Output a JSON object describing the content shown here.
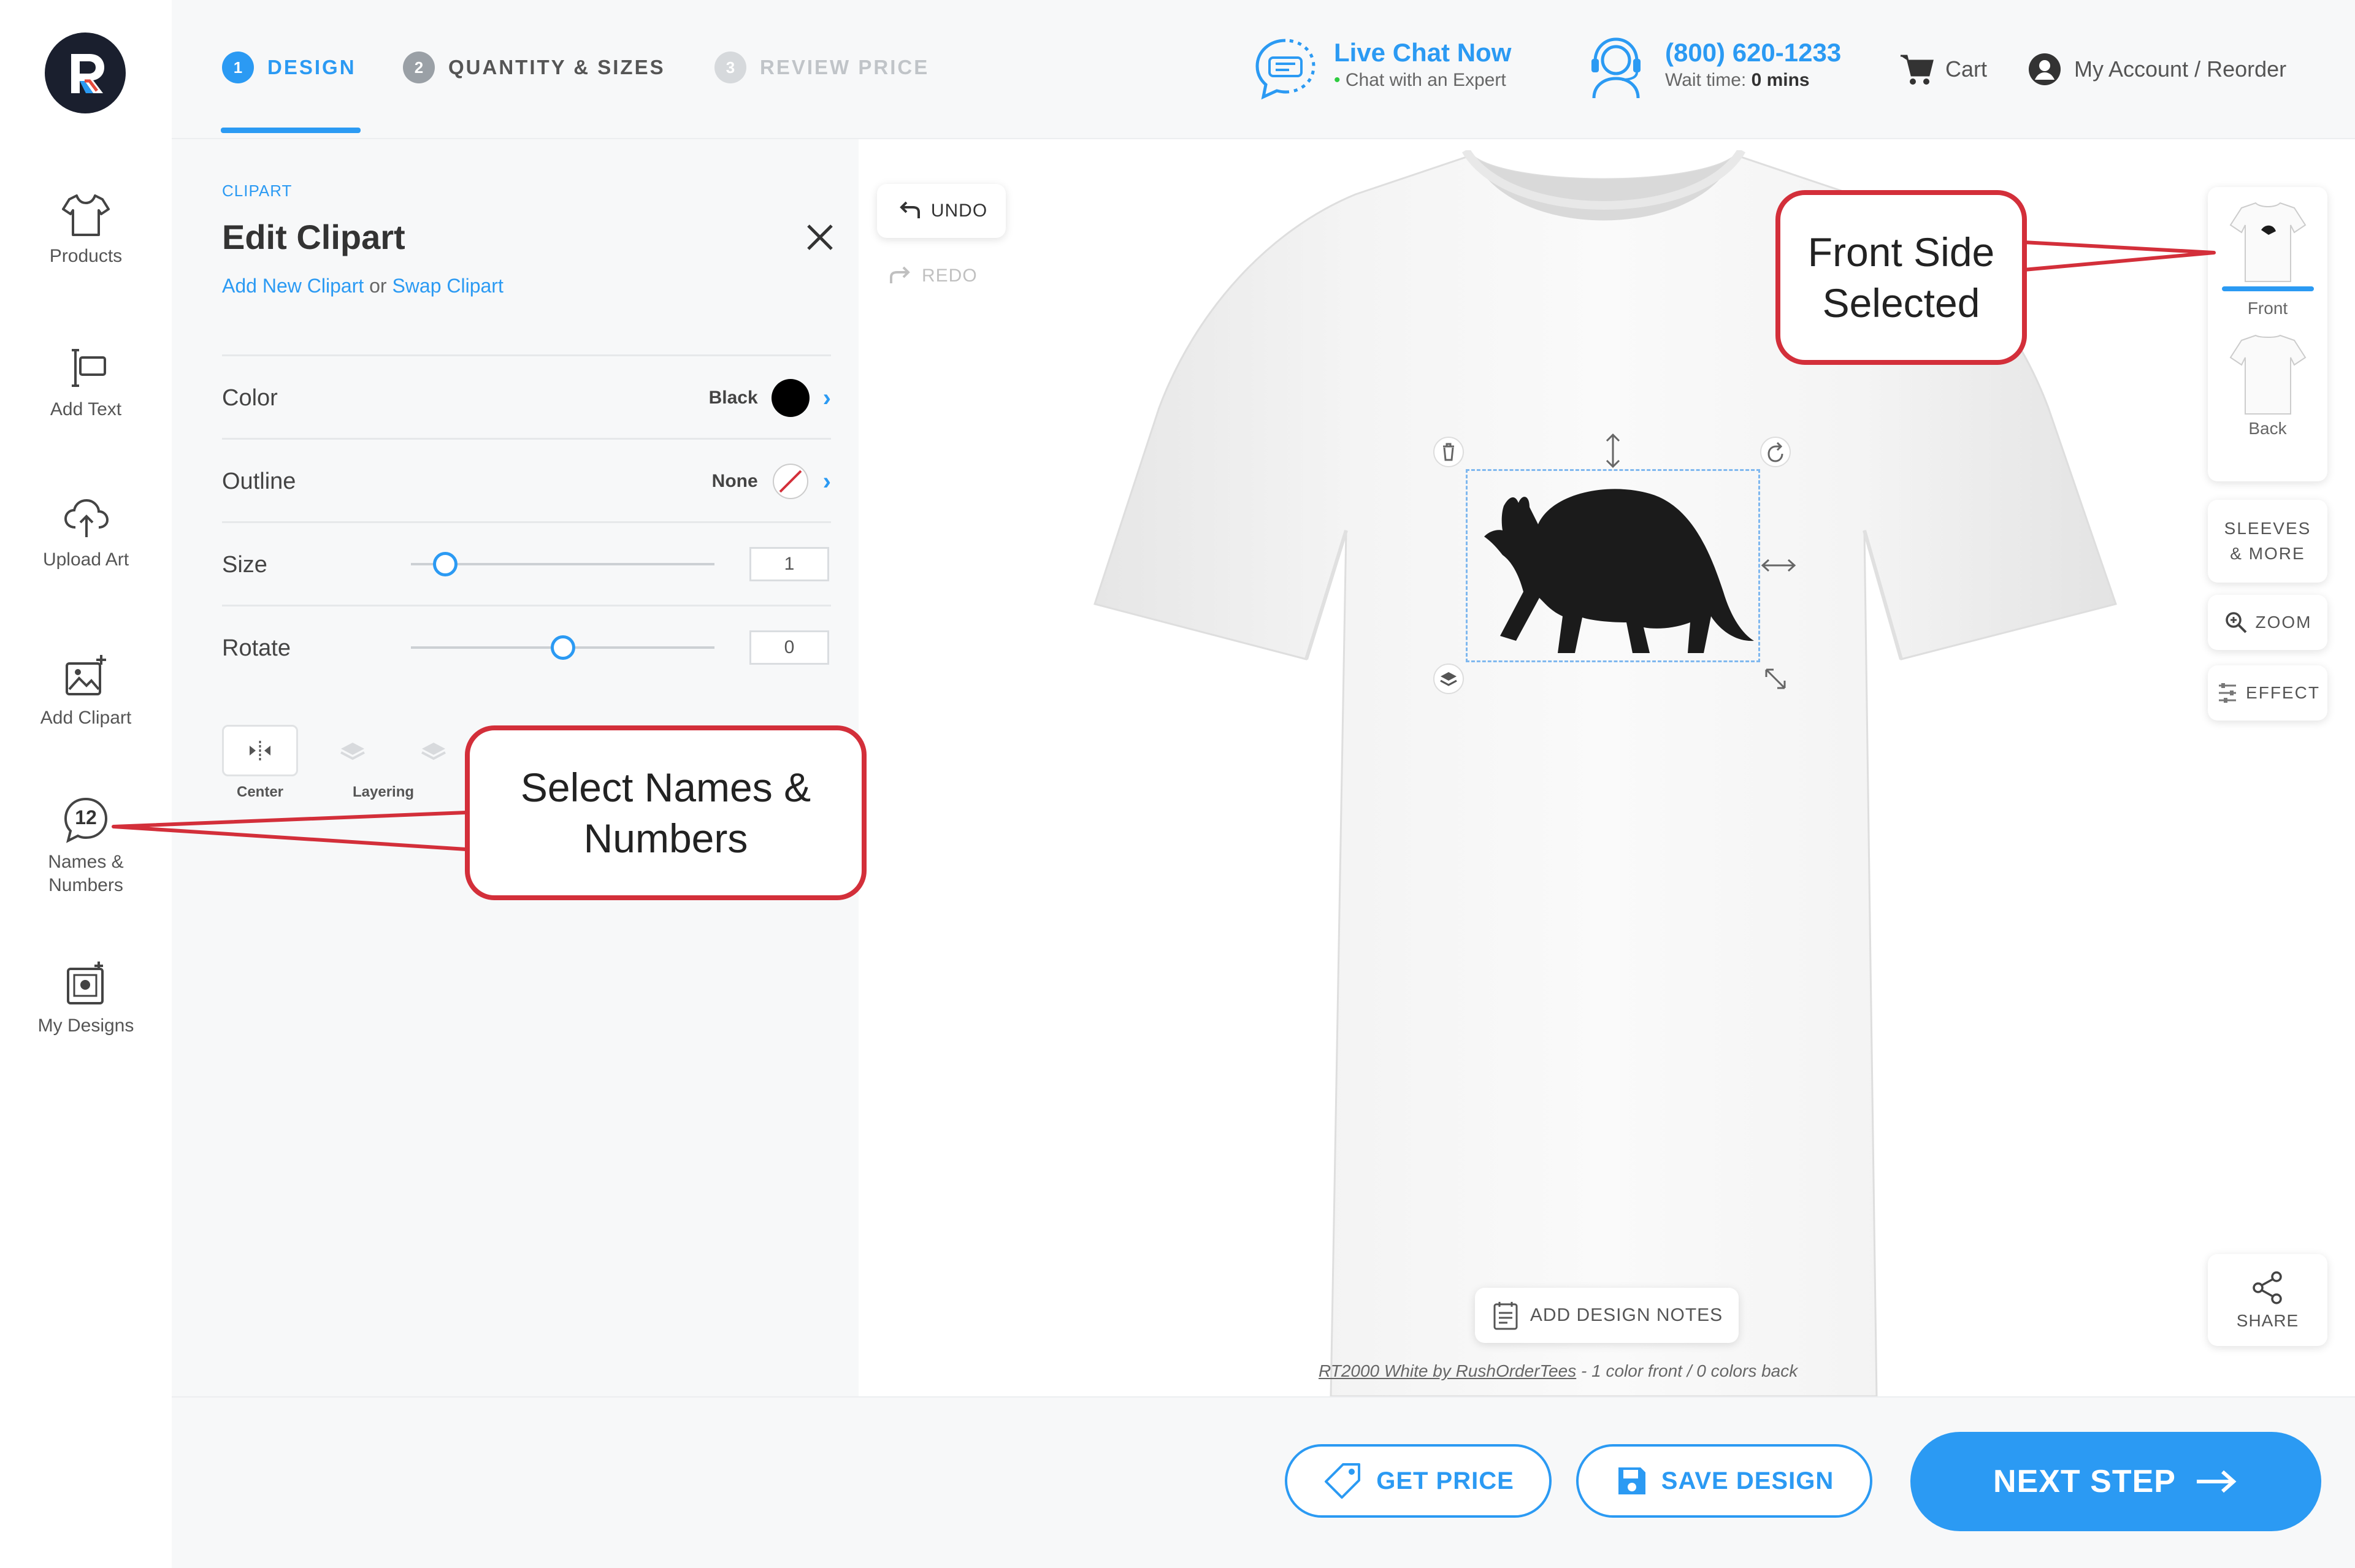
{
  "rail": {
    "items": [
      {
        "label": "Products",
        "icon": "tshirt-icon"
      },
      {
        "label": "Add Text",
        "icon": "text-cursor-icon"
      },
      {
        "label": "Upload Art",
        "icon": "cloud-upload-icon"
      },
      {
        "label": "Add Clipart",
        "icon": "image-plus-icon"
      },
      {
        "label": "Names &\nNumbers",
        "icon": "number-badge-icon",
        "badge": "12"
      },
      {
        "label": "My Designs",
        "icon": "saved-designs-icon"
      }
    ]
  },
  "header": {
    "steps": [
      {
        "num": "1",
        "label": "DESIGN",
        "state": "active"
      },
      {
        "num": "2",
        "label": "QUANTITY & SIZES",
        "state": "inactive"
      },
      {
        "num": "3",
        "label": "REVIEW PRICE",
        "state": "disabled"
      }
    ],
    "chat": {
      "title": "Live Chat Now",
      "subtitle": "Chat with an Expert",
      "status_dot": "•"
    },
    "phone": {
      "number": "(800) 620-1233",
      "wait_prefix": "Wait time: ",
      "wait_value": "0 mins"
    },
    "cart_label": "Cart",
    "account_label": "My Account / Reorder"
  },
  "panel": {
    "eyebrow": "CLIPART",
    "title": "Edit Clipart",
    "subtitle_link1": "Add New Clipart",
    "subtitle_or": " or ",
    "subtitle_link2": "Swap Clipart",
    "rows": {
      "color": {
        "label": "Color",
        "value": "Black"
      },
      "outline": {
        "label": "Outline",
        "value": "None"
      },
      "size": {
        "label": "Size",
        "value": "1"
      },
      "rotate": {
        "label": "Rotate",
        "value": "0"
      }
    },
    "actions": {
      "center": "Center",
      "layering": "Layering"
    }
  },
  "canvas": {
    "undo": "UNDO",
    "redo": "REDO",
    "views": {
      "front": "Front",
      "back": "Back"
    },
    "sleeves": "SLEEVES\n& MORE",
    "zoom": "ZOOM",
    "effect": "EFFECT",
    "share": "SHARE",
    "design_notes": "ADD DESIGN NOTES",
    "caption_link": "RT2000 White by RushOrderTees",
    "caption_rest": " - 1 color front  /  0 colors back"
  },
  "footer": {
    "get_price": "GET PRICE",
    "save_design": "SAVE DESIGN",
    "next_step": "NEXT STEP"
  },
  "callouts": {
    "front": "Front Side\nSelected",
    "names": "Select Names &\nNumbers"
  },
  "colors": {
    "accent": "#2b9af3",
    "callout_red": "#d32f3a",
    "clipart": "#1b1b1b",
    "rail_dark": "#1a1f2e"
  }
}
